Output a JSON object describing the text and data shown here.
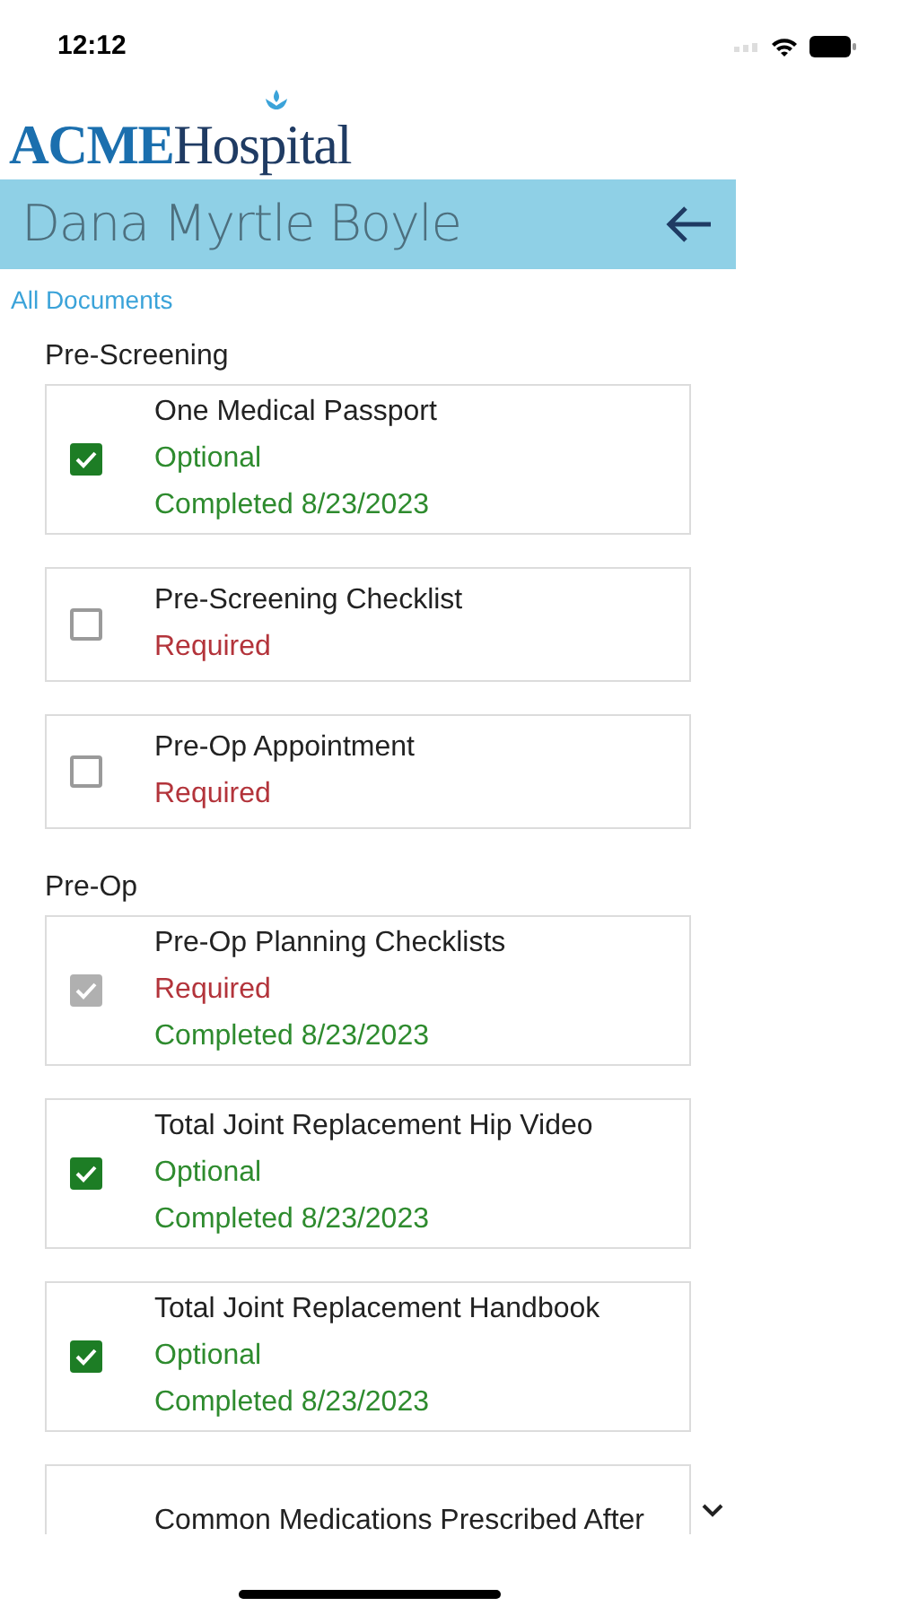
{
  "status_bar": {
    "time": "12:12"
  },
  "logo": {
    "brand": "ACME",
    "name": "Hospital"
  },
  "header": {
    "title": "Dana Myrtle Boyle"
  },
  "breadcrumb": "All Documents",
  "sections": [
    {
      "title": "Pre-Screening",
      "items": [
        {
          "title": "One Medical Passport",
          "status": "Optional",
          "required": false,
          "completed": "Completed 8/23/2023",
          "checked": true,
          "disabled": false
        },
        {
          "title": "Pre-Screening Checklist",
          "status": "Required",
          "required": true,
          "checked": false,
          "disabled": false
        },
        {
          "title": "Pre-Op Appointment",
          "status": "Required",
          "required": true,
          "checked": false,
          "disabled": false
        }
      ]
    },
    {
      "title": "Pre-Op",
      "items": [
        {
          "title": "Pre-Op Planning Checklists",
          "status": "Required",
          "required": true,
          "completed": "Completed 8/23/2023",
          "checked": true,
          "disabled": true
        },
        {
          "title": "Total Joint Replacement Hip Video",
          "status": "Optional",
          "required": false,
          "completed": "Completed 8/23/2023",
          "checked": true,
          "disabled": false
        },
        {
          "title": "Total Joint Replacement Handbook",
          "status": "Optional",
          "required": false,
          "completed": "Completed 8/23/2023",
          "checked": true,
          "disabled": false
        },
        {
          "title": "Common Medications Prescribed After",
          "expandable": true
        }
      ]
    }
  ]
}
